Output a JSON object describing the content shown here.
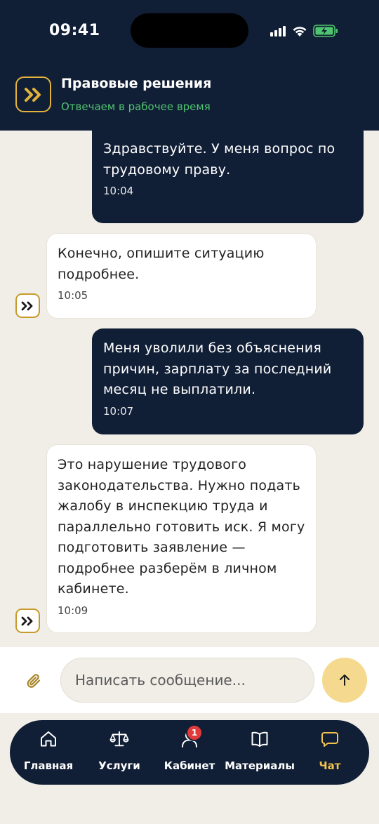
{
  "status_bar": {
    "time": "09:41"
  },
  "header": {
    "title": "Правовые решения",
    "subtitle": "Отвечаем в рабочее время",
    "logo_icon": "double-chevron-right-icon",
    "accent_color": "#e3b23c",
    "online_color": "#4fc46f"
  },
  "messages": [
    {
      "from": "user",
      "text": "Здравствуйте. У меня вопрос по трудовому праву.",
      "time": "10:04"
    },
    {
      "from": "agent",
      "text": "Конечно, опишите ситуацию подробнее.",
      "time": "10:05"
    },
    {
      "from": "user",
      "text": "Меня уволили без объяснения причин, зарплату за последний месяц не выплатили.",
      "time": "10:07"
    },
    {
      "from": "agent",
      "text": "Это нарушение трудового законодательства. Нужно подать жалобу в инспекцию труда и параллельно готовить иск. Я могу подготовить заявление — подробнее разберём в личном кабинете.",
      "time": "10:09"
    }
  ],
  "composer": {
    "placeholder": "Написать сообщение...",
    "attach_icon": "paperclip-icon",
    "send_icon": "arrow-up-icon"
  },
  "nav": {
    "items": [
      {
        "label": "Главная",
        "icon": "home-icon"
      },
      {
        "label": "Услуги",
        "icon": "scales-icon"
      },
      {
        "label": "Кабинет",
        "icon": "user-icon",
        "badge": "1"
      },
      {
        "label": "Материалы",
        "icon": "book-icon"
      },
      {
        "label": "Чат",
        "icon": "chat-icon",
        "active": true
      }
    ]
  }
}
